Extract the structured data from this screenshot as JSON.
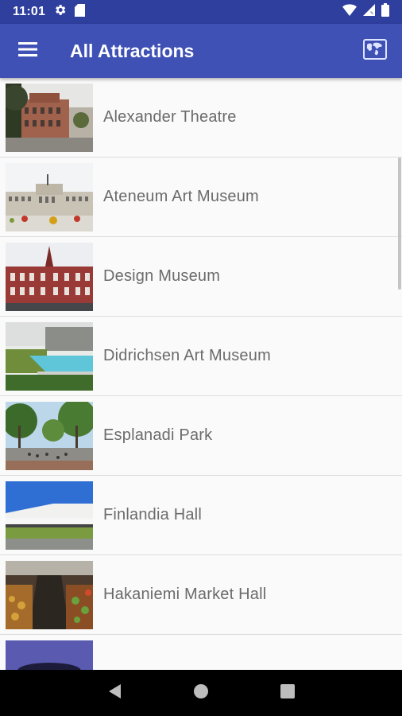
{
  "status_bar": {
    "time": "11:01",
    "icons": [
      "gear-icon",
      "sd-card-icon",
      "wifi-icon",
      "cellular-signal-icon",
      "battery-icon"
    ]
  },
  "app_bar": {
    "title": "All Attractions",
    "menu_icon": "hamburger-menu-icon",
    "action_icon": "map-icon"
  },
  "attractions": [
    {
      "label": "Alexander Theatre"
    },
    {
      "label": "Ateneum Art Museum"
    },
    {
      "label": "Design Museum"
    },
    {
      "label": "Didrichsen Art Museum"
    },
    {
      "label": "Esplanadi Park"
    },
    {
      "label": "Finlandia Hall"
    },
    {
      "label": "Hakaniemi Market Hall"
    },
    {
      "label": ""
    }
  ],
  "nav_bar": {
    "buttons": [
      "back-icon",
      "home-icon",
      "recents-icon"
    ]
  },
  "colors": {
    "primary": "#3f51b5",
    "primary_dark": "#2e3f9e",
    "text_secondary": "#6b6b6b",
    "divider": "#dcdcdc"
  }
}
